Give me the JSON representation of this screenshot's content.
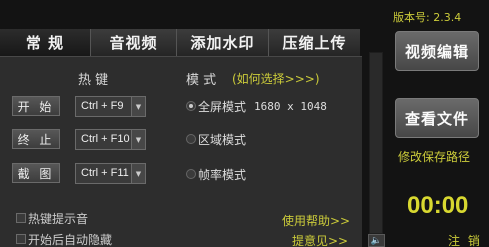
{
  "tabs": [
    {
      "label": "常 规"
    },
    {
      "label": "音视频"
    },
    {
      "label": "添加水印"
    },
    {
      "label": "压缩上传"
    }
  ],
  "general": {
    "hotkey_header": "热 键",
    "mode_header": "模 式",
    "how_to_choose": "(如何选择>>>)",
    "actions": [
      {
        "label": "开 始",
        "hotkey": "Ctrl + F9"
      },
      {
        "label": "终 止",
        "hotkey": "Ctrl + F10"
      },
      {
        "label": "截 图",
        "hotkey": "Ctrl + F11"
      }
    ],
    "modes": [
      {
        "label": "全屏模式",
        "resolution": "1680 x 1048",
        "selected": true
      },
      {
        "label": "区域模式",
        "selected": false
      },
      {
        "label": "帧率模式",
        "selected": false
      }
    ],
    "hotkey_sound_label": "热键提示音",
    "auto_hide_label": "开始后自动隐藏",
    "help_link": "使用帮助>>",
    "feedback_link": "提意见>>"
  },
  "sidebar": {
    "version": "版本号: 2.3.4",
    "video_edit_button": "视频编辑",
    "view_files_button": "查看文件",
    "change_save_path": "修改保存路径",
    "timer": "00:00",
    "logout": "注 销"
  },
  "colors": {
    "accent_yellow": "#cccc3a",
    "panel_bg": "#2d2d2d",
    "window_bg": "#131313"
  },
  "icons": {
    "speaker": "speaker-icon",
    "dropdown": "chevron-down-icon"
  }
}
